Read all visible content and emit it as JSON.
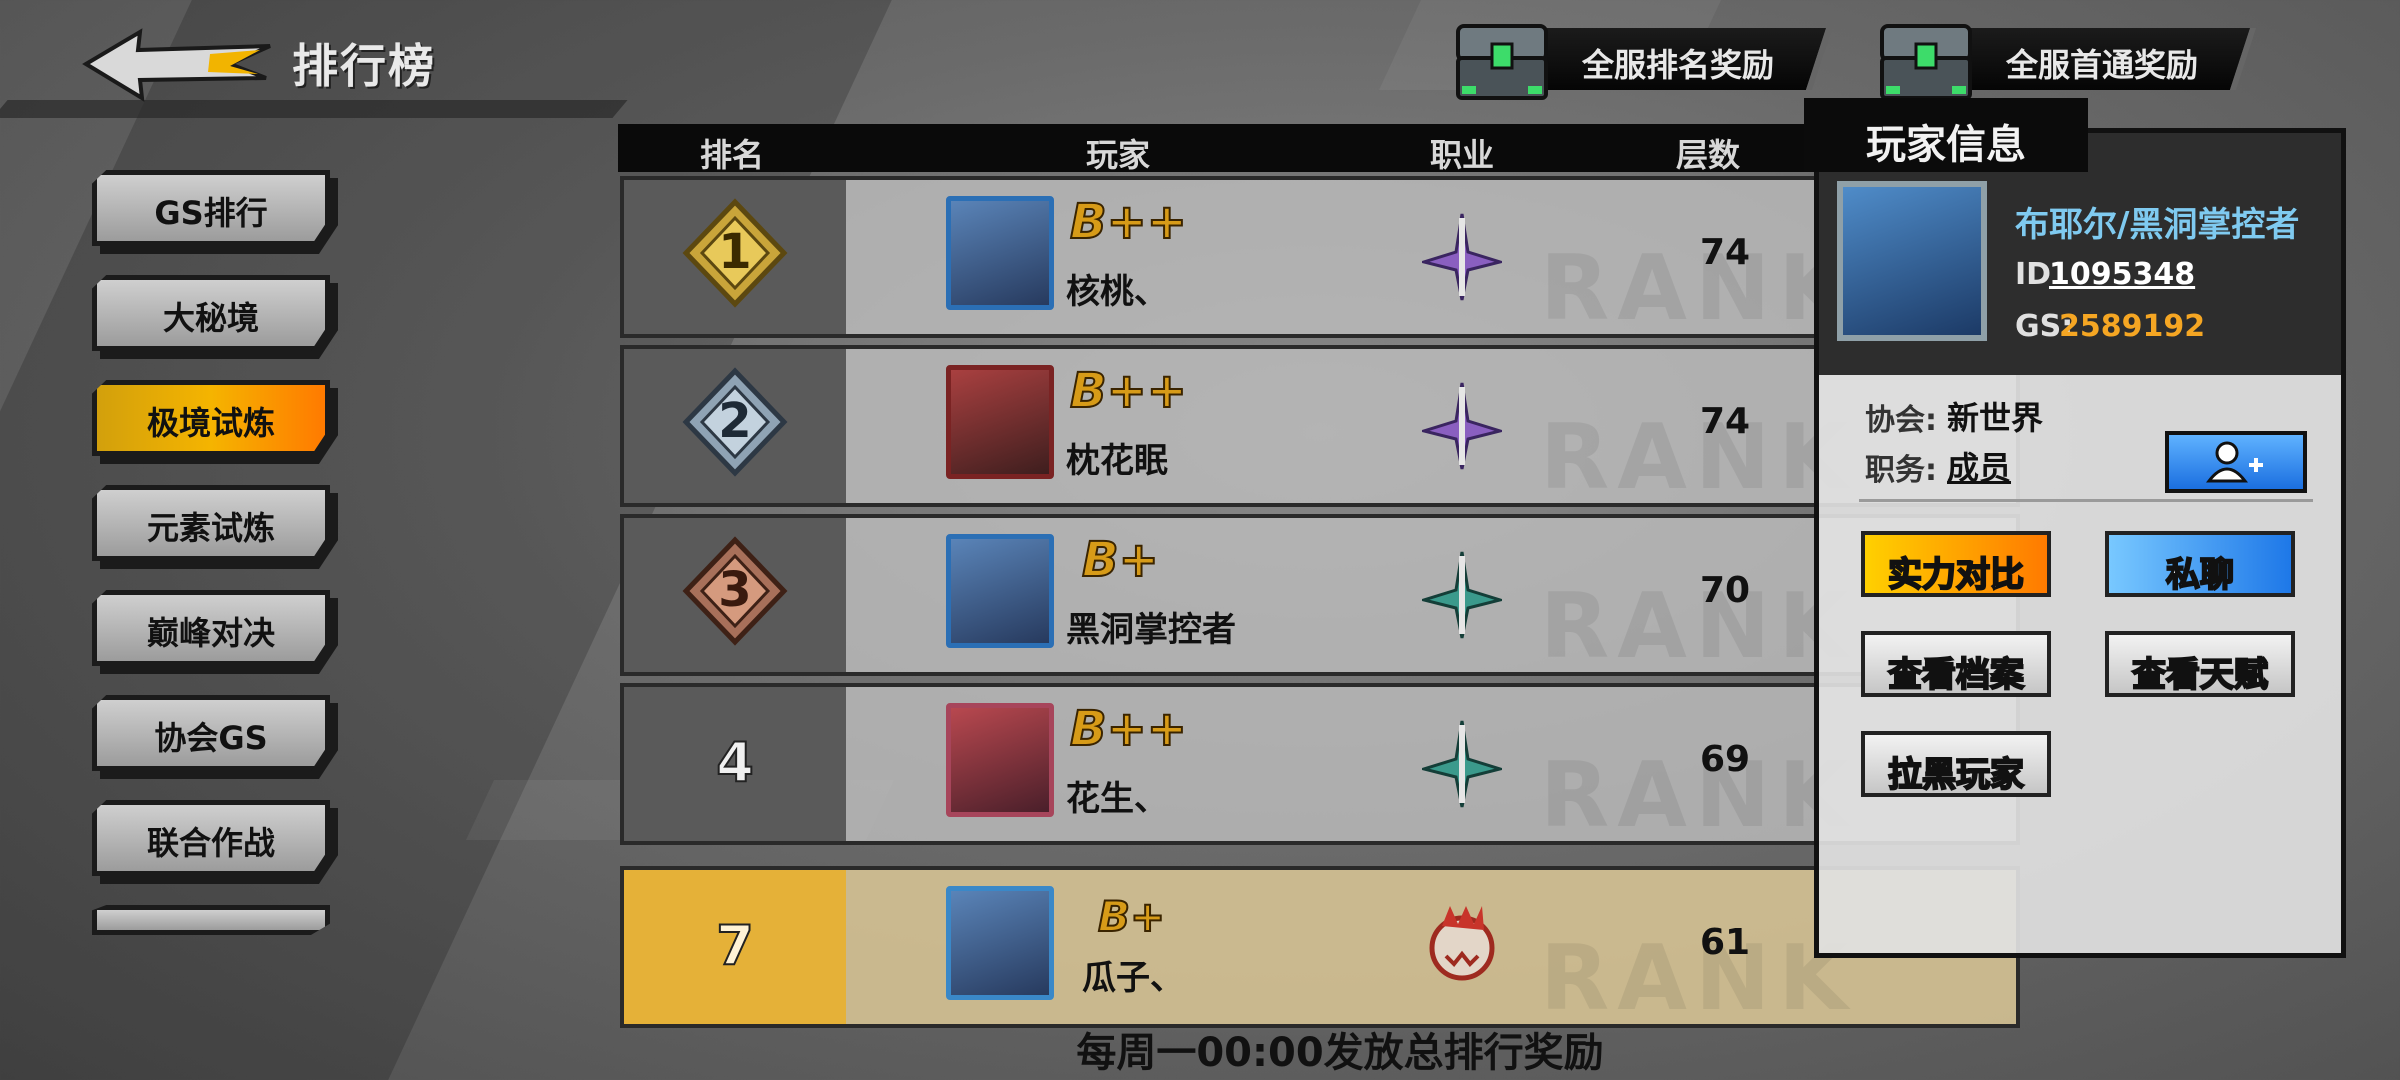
{
  "header": {
    "title": "排行榜",
    "reward_buttons": [
      "全服排名奖励",
      "全服首通奖励"
    ]
  },
  "tabs": [
    {
      "label": "GS排行",
      "active": false
    },
    {
      "label": "大秘境",
      "active": false
    },
    {
      "label": "极境试炼",
      "active": true
    },
    {
      "label": "元素试炼",
      "active": false
    },
    {
      "label": "巅峰对决",
      "active": false
    },
    {
      "label": "协会GS",
      "active": false
    },
    {
      "label": "联合作战",
      "active": false
    }
  ],
  "table": {
    "columns": [
      "排名",
      "玩家",
      "职业",
      "层数"
    ],
    "watermark": "RANK",
    "rows": [
      {
        "rank": "1",
        "grade": "B++",
        "name": "核桃、",
        "floor": "74",
        "job_icon": "purple-sword-icon",
        "medal": "gold"
      },
      {
        "rank": "2",
        "grade": "B++",
        "name": "枕花眠",
        "floor": "74",
        "job_icon": "purple-sword-icon",
        "medal": "silver"
      },
      {
        "rank": "3",
        "grade": "B+",
        "name": "黑洞掌控者",
        "floor": "70",
        "job_icon": "teal-sword-icon",
        "medal": "bronze"
      },
      {
        "rank": "4",
        "grade": "B++",
        "name": "花生、",
        "floor": "69",
        "job_icon": "teal-sword-icon",
        "medal": ""
      },
      {
        "rank": "7",
        "grade": "B+",
        "name": "瓜子、",
        "floor": "61",
        "job_icon": "red-beast-icon",
        "medal": ""
      }
    ]
  },
  "footer_note": "每周一00:00发放总排行奖励",
  "player_info": {
    "tab_label": "玩家信息",
    "name": "布耶尔/黑洞掌控者",
    "id_label": "ID",
    "id": "1095348",
    "gs_label": "GS:",
    "gs": "2589192",
    "guild_label": "协会:",
    "guild": "新世界",
    "role_label": "职务:",
    "role": "成员",
    "actions": [
      "实力对比",
      "私聊",
      "查看档案",
      "查看天赋",
      "拉黑玩家"
    ]
  },
  "colors": {
    "accent_orange": "#f5a623",
    "name_blue": "#7fcaf0",
    "active_tab": "#f5b400"
  }
}
